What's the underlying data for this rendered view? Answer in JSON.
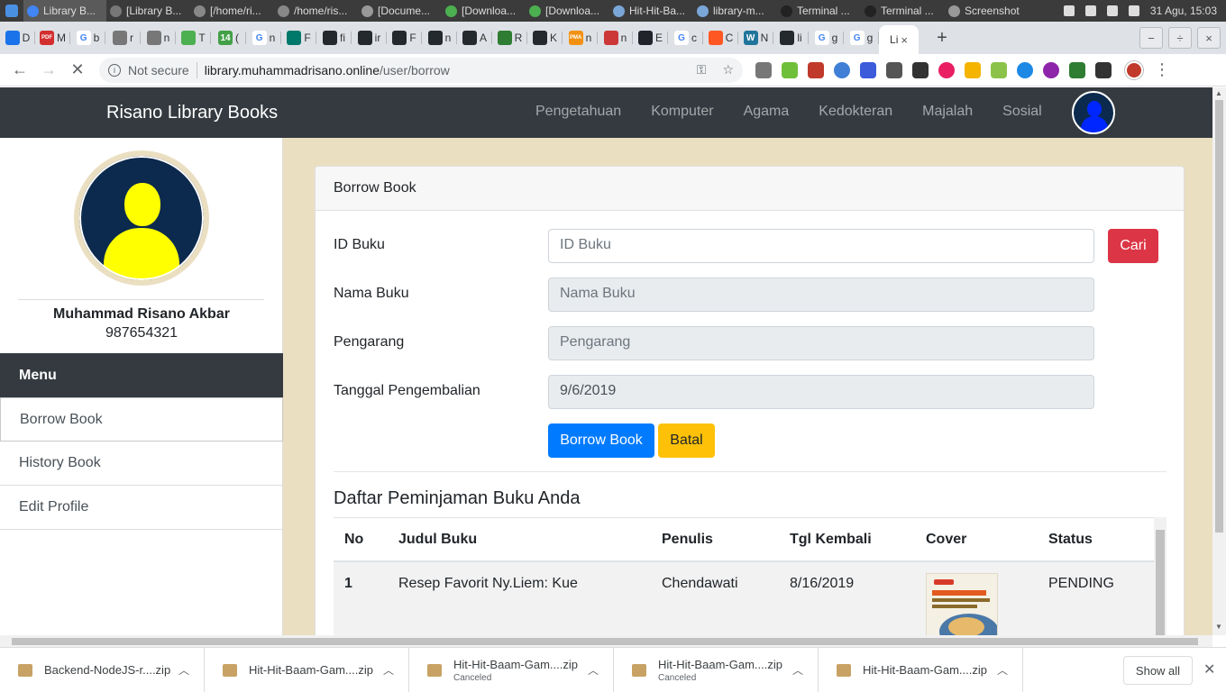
{
  "os_bar": {
    "tasks": [
      {
        "label": "Library B...",
        "color": "#4285f4"
      },
      {
        "label": "[Library B...",
        "color": "#777777"
      },
      {
        "label": "[/home/ri...",
        "color": "#888888"
      },
      {
        "label": "/home/ris...",
        "color": "#888888"
      },
      {
        "label": "[Docume...",
        "color": "#999999"
      },
      {
        "label": "[Downloa...",
        "color": "#4caf50"
      },
      {
        "label": "[Downloa...",
        "color": "#4caf50"
      },
      {
        "label": "Hit-Hit-Ba...",
        "color": "#7aa7d8"
      },
      {
        "label": "library-m...",
        "color": "#7aa7d8"
      },
      {
        "label": "Terminal ...",
        "color": "#222222"
      },
      {
        "label": "Terminal ...",
        "color": "#222222"
      },
      {
        "label": "Screenshot",
        "color": "#999999"
      }
    ],
    "clock": "31 Agu, 15:03"
  },
  "tabs": [
    {
      "label": "D",
      "icon": "chrome-icon",
      "color": "#1a73e8",
      "glyph": ""
    },
    {
      "label": "M",
      "icon": "pdf-icon",
      "color": "#d32f2f",
      "glyph": "PDF"
    },
    {
      "label": "b",
      "icon": "google-icon",
      "color": "#ffffff",
      "glyph": "G"
    },
    {
      "label": "r",
      "icon": "globe-icon",
      "color": "#777777",
      "glyph": ""
    },
    {
      "label": "n",
      "icon": "globe-icon",
      "color": "#777777",
      "glyph": ""
    },
    {
      "label": "T",
      "icon": "leaf-icon",
      "color": "#4caf50",
      "glyph": ""
    },
    {
      "label": "(",
      "icon": "badge-icon",
      "color": "#43a047",
      "glyph": "14"
    },
    {
      "label": "n",
      "icon": "google-icon",
      "color": "#ffffff",
      "glyph": "G"
    },
    {
      "label": "F",
      "icon": "circle-icon",
      "color": "#00796b",
      "glyph": ""
    },
    {
      "label": "fi",
      "icon": "github-icon",
      "color": "#24292e",
      "glyph": ""
    },
    {
      "label": "ir",
      "icon": "github-icon",
      "color": "#24292e",
      "glyph": ""
    },
    {
      "label": "F",
      "icon": "github-icon",
      "color": "#24292e",
      "glyph": ""
    },
    {
      "label": "n",
      "icon": "github-icon",
      "color": "#24292e",
      "glyph": ""
    },
    {
      "label": "A",
      "icon": "github-icon",
      "color": "#24292e",
      "glyph": ""
    },
    {
      "label": "R",
      "icon": "cross-icon",
      "color": "#2e7d32",
      "glyph": ""
    },
    {
      "label": "K",
      "icon": "github-icon",
      "color": "#24292e",
      "glyph": ""
    },
    {
      "label": "n",
      "icon": "pma-icon",
      "color": "#f29111",
      "glyph": "PMA"
    },
    {
      "label": "n",
      "icon": "npm-icon",
      "color": "#cb3837",
      "glyph": ""
    },
    {
      "label": "E",
      "icon": "react-icon",
      "color": "#20232a",
      "glyph": ""
    },
    {
      "label": "c",
      "icon": "google-icon",
      "color": "#ffffff",
      "glyph": "G"
    },
    {
      "label": "C",
      "icon": "blogger-icon",
      "color": "#ff5722",
      "glyph": ""
    },
    {
      "label": "N",
      "icon": "wordpress-icon",
      "color": "#21759b",
      "glyph": "W"
    },
    {
      "label": "li",
      "icon": "github-icon",
      "color": "#24292e",
      "glyph": ""
    },
    {
      "label": "g",
      "icon": "google-icon",
      "color": "#ffffff",
      "glyph": "G"
    },
    {
      "label": "g",
      "icon": "google-icon",
      "color": "#ffffff",
      "glyph": "G"
    }
  ],
  "active_tab": {
    "label": "Li",
    "close": "×"
  },
  "window_controls": [
    "−",
    "÷",
    "×"
  ],
  "address": {
    "security": "Not secure",
    "host": "library.muhammadrisano.online",
    "path": "/user/borrow"
  },
  "navbar": {
    "brand": "Risano Library Books",
    "links": [
      "Pengetahuan",
      "Komputer",
      "Agama",
      "Kedokteran",
      "Majalah",
      "Sosial"
    ]
  },
  "sidebar": {
    "name": "Muhammad Risano Akbar",
    "id_number": "987654321",
    "menu_title": "Menu",
    "items": [
      {
        "label": "Borrow Book",
        "active": true
      },
      {
        "label": "History Book",
        "active": false
      },
      {
        "label": "Edit Profile",
        "active": false
      }
    ]
  },
  "borrow": {
    "card_title": "Borrow Book",
    "id_label": "ID Buku",
    "id_placeholder": "ID Buku",
    "search_btn": "Cari",
    "name_label": "Nama Buku",
    "name_placeholder": "Nama Buku",
    "author_label": "Pengarang",
    "author_placeholder": "Pengarang",
    "return_label": "Tanggal Pengembalian",
    "return_value": "9/6/2019",
    "borrow_btn": "Borrow Book",
    "cancel_btn": "Batal"
  },
  "list": {
    "title": "Daftar Peminjaman Buku Anda",
    "columns": [
      "No",
      "Judul Buku",
      "Penulis",
      "Tgl Kembali",
      "Cover",
      "Status"
    ],
    "rows": [
      {
        "no": "1",
        "title": "Resep Favorit Ny.Liem: Kue",
        "author": "Chendawati",
        "return_date": "8/16/2019",
        "status": "PENDING"
      }
    ]
  },
  "downloads": {
    "items": [
      {
        "name": "Backend-NodeJS-r....zip",
        "status": ""
      },
      {
        "name": "Hit-Hit-Baam-Gam....zip",
        "status": ""
      },
      {
        "name": "Hit-Hit-Baam-Gam....zip",
        "status": "Canceled"
      },
      {
        "name": "Hit-Hit-Baam-Gam....zip",
        "status": "Canceled"
      },
      {
        "name": "Hit-Hit-Baam-Gam....zip",
        "status": ""
      }
    ],
    "show_all": "Show all"
  }
}
